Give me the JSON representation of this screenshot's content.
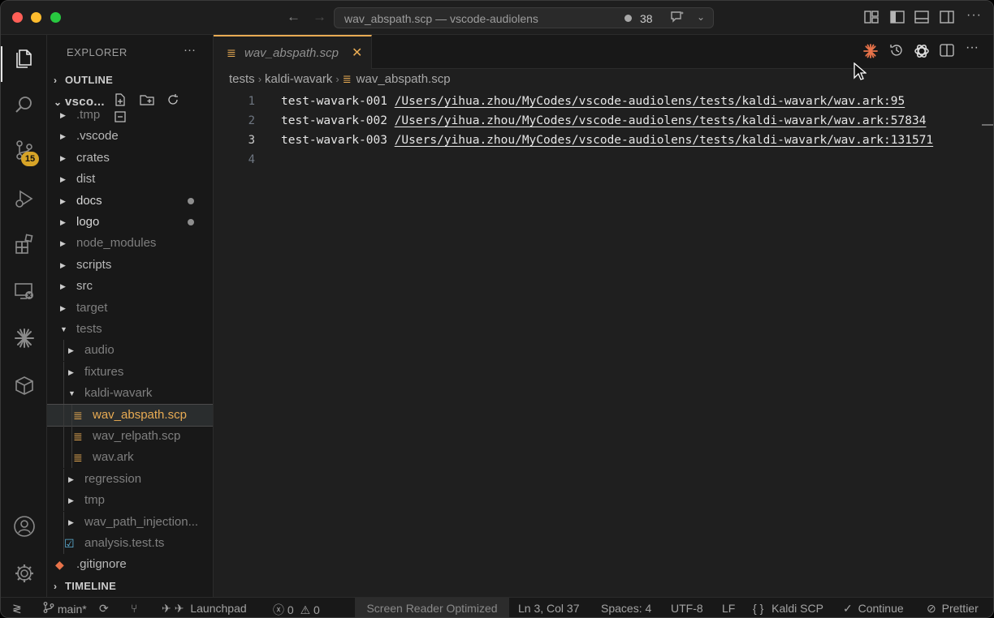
{
  "window": {
    "title": "wav_abspath.scp — vscode-audiolens",
    "notification_count": "38"
  },
  "activity": {
    "scm_badge": "15",
    "icons": [
      "files-icon",
      "search-icon",
      "source-control-icon",
      "run-debug-icon",
      "extensions-icon",
      "remote-explorer-icon",
      "claude-icon",
      "package-icon",
      "account-icon",
      "settings-gear-icon"
    ]
  },
  "sidebar": {
    "title": "EXPLORER",
    "outline": "OUTLINE",
    "project": "vsco...",
    "timeline": "TIMELINE",
    "tree": [
      {
        "label": ".tmp",
        "type": "folder",
        "depth": 1,
        "style": "dim"
      },
      {
        "label": ".vscode",
        "type": "folder",
        "depth": 1,
        "style": "normal"
      },
      {
        "label": "crates",
        "type": "folder",
        "depth": 1,
        "style": "normal"
      },
      {
        "label": "dist",
        "type": "folder",
        "depth": 1,
        "style": "normal"
      },
      {
        "label": "docs",
        "type": "folder",
        "depth": 1,
        "style": "bright",
        "modified": true
      },
      {
        "label": "logo",
        "type": "folder",
        "depth": 1,
        "style": "bright",
        "modified": true
      },
      {
        "label": "node_modules",
        "type": "folder",
        "depth": 1,
        "style": "dim"
      },
      {
        "label": "scripts",
        "type": "folder",
        "depth": 1,
        "style": "normal"
      },
      {
        "label": "src",
        "type": "folder",
        "depth": 1,
        "style": "normal"
      },
      {
        "label": "target",
        "type": "folder",
        "depth": 1,
        "style": "dim"
      },
      {
        "label": "tests",
        "type": "folder-open",
        "depth": 1,
        "style": "dim"
      },
      {
        "label": "audio",
        "type": "folder",
        "depth": 2,
        "style": "dim"
      },
      {
        "label": "fixtures",
        "type": "folder",
        "depth": 2,
        "style": "dim"
      },
      {
        "label": "kaldi-wavark",
        "type": "folder-open",
        "depth": 2,
        "style": "dim"
      },
      {
        "label": "wav_abspath.scp",
        "type": "file",
        "depth": 3,
        "style": "selected"
      },
      {
        "label": "wav_relpath.scp",
        "type": "file",
        "depth": 3,
        "style": "dim"
      },
      {
        "label": "wav.ark",
        "type": "file",
        "depth": 3,
        "style": "dim"
      },
      {
        "label": "regression",
        "type": "folder",
        "depth": 2,
        "style": "dim"
      },
      {
        "label": "tmp",
        "type": "folder",
        "depth": 2,
        "style": "dim"
      },
      {
        "label": "wav_path_injection...",
        "type": "folder",
        "depth": 2,
        "style": "dim"
      },
      {
        "label": "analysis.test.ts",
        "type": "test-file",
        "depth": 2,
        "style": "dim"
      },
      {
        "label": ".gitignore",
        "type": "git-file",
        "depth": 1,
        "style": "normal"
      }
    ]
  },
  "editor": {
    "tab_label": "wav_abspath.scp",
    "breadcrumb": [
      "tests",
      "kaldi-wavark",
      "wav_abspath.scp"
    ],
    "lines": [
      {
        "num": "1",
        "key": "test-wavark-001",
        "path": "/Users/yihua.zhou/MyCodes/vscode-audiolens/tests/kaldi-wavark/wav.ark:95"
      },
      {
        "num": "2",
        "key": "test-wavark-002",
        "path": "/Users/yihua.zhou/MyCodes/vscode-audiolens/tests/kaldi-wavark/wav.ark:57834"
      },
      {
        "num": "3",
        "key": "test-wavark-003",
        "path": "/Users/yihua.zhou/MyCodes/vscode-audiolens/tests/kaldi-wavark/wav.ark:131571"
      },
      {
        "num": "4",
        "key": "",
        "path": ""
      }
    ]
  },
  "status": {
    "branch": "main*",
    "launchpad": "Launchpad",
    "errors": "0",
    "warnings": "0",
    "screen_reader": "Screen Reader Optimized",
    "position": "Ln 3, Col 37",
    "spaces": "Spaces: 4",
    "encoding": "UTF-8",
    "eol": "LF",
    "language": "Kaldi SCP",
    "continue": "Continue",
    "prettier": "Prettier"
  },
  "colors": {
    "accent": "#e8ab53",
    "badge": "#d7a427",
    "claude": "#e8734a"
  }
}
